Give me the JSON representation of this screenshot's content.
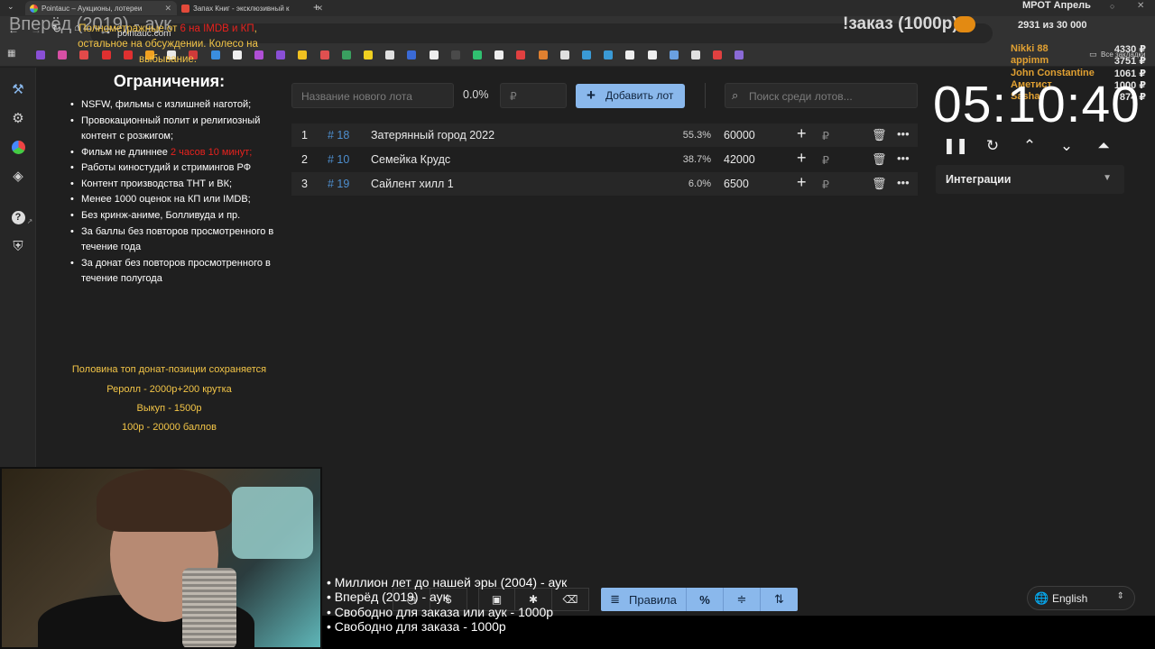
{
  "browser": {
    "tabs": [
      {
        "title": "Pointauc – Аукционы, лотереи",
        "active": true
      },
      {
        "title": "Запах Книг - эксклюзивный к",
        "active": false
      }
    ],
    "new_tab": "+",
    "url": "pointauc.com",
    "bookmarks_label": "Все закладки"
  },
  "overlay": {
    "title": "Вперёд (2019) - аук",
    "order": "!заказ (1000р)",
    "goal_name": "МРОТ Апрель",
    "goal_progress": "2931  из 30 000",
    "donors": [
      {
        "name": "Nikki 88",
        "amount": "4330 ₽"
      },
      {
        "name": "appimm",
        "amount": "3751 ₽"
      },
      {
        "name": "John Constantine",
        "amount": "1061 ₽"
      },
      {
        "name": "Аметист",
        "amount": "1000 ₽"
      },
      {
        "name": "Sasha",
        "amount": "874 ₽"
      }
    ]
  },
  "rules": {
    "intro_a": "Полнометражные от ",
    "intro_red": "6 на IMDB и КП",
    "intro_b": ", остальное на обсуждении. Колесо на выбывание.",
    "title": "Ограничения:",
    "items": [
      "NSFW, фильмы с излишней наготой;",
      "Провокационный полит и религиозный контент с розжигом;",
      "Фильм не длиннее ",
      "Работы киностудий и стримингов РФ",
      "Контент производства ТНТ и ВК;",
      "Менее 1000 оценок на КП или IMDB;",
      "Без кринж-аниме, Болливуда и пр.",
      "За баллы без повторов просмотренного в течение года",
      "За донат без повторов просмотренного в течение полугода"
    ],
    "length_red": "2 часов 10 минут;",
    "foot": [
      "Половина топ донат-позиции сохраняется",
      "Реролл - 2000р+200 крутка",
      "Выкуп - 1500р",
      "100р - 20000 баллов"
    ]
  },
  "controls": {
    "new_lot_placeholder": "Название нового лота",
    "percent": "0.0%",
    "amount_placeholder": "₽",
    "add_lot": "Добавить лот",
    "search_placeholder": "Поиск среди лотов..."
  },
  "lots": [
    {
      "n": "1",
      "id": "# 18",
      "name": "Затерянный город 2022",
      "pct": "55.3%",
      "amount": "60000"
    },
    {
      "n": "2",
      "id": "# 10",
      "name": "Семейка Крудс",
      "pct": "38.7%",
      "amount": "42000"
    },
    {
      "n": "3",
      "id": "# 19",
      "name": "Сайлент хилл 1",
      "pct": "6.0%",
      "amount": "6500"
    }
  ],
  "lot_currency": "₽",
  "timer": "05:10:40",
  "integrations": "Интеграции",
  "bottom": {
    "rules_btn": "Правила",
    "language": "English"
  },
  "ticker": [
    "• Миллион лет до нашей эры (2004) - аук",
    "• Вперёд (2019) - аук",
    "• Свободно для заказа или аук - 1000р",
    "• Свободно для заказа - 1000р"
  ],
  "colors": {
    "accent": "#8ab8ec",
    "warning": "#f3c547",
    "danger": "#e8221e",
    "link": "#4e8fcf",
    "donor": "#e0a032"
  }
}
